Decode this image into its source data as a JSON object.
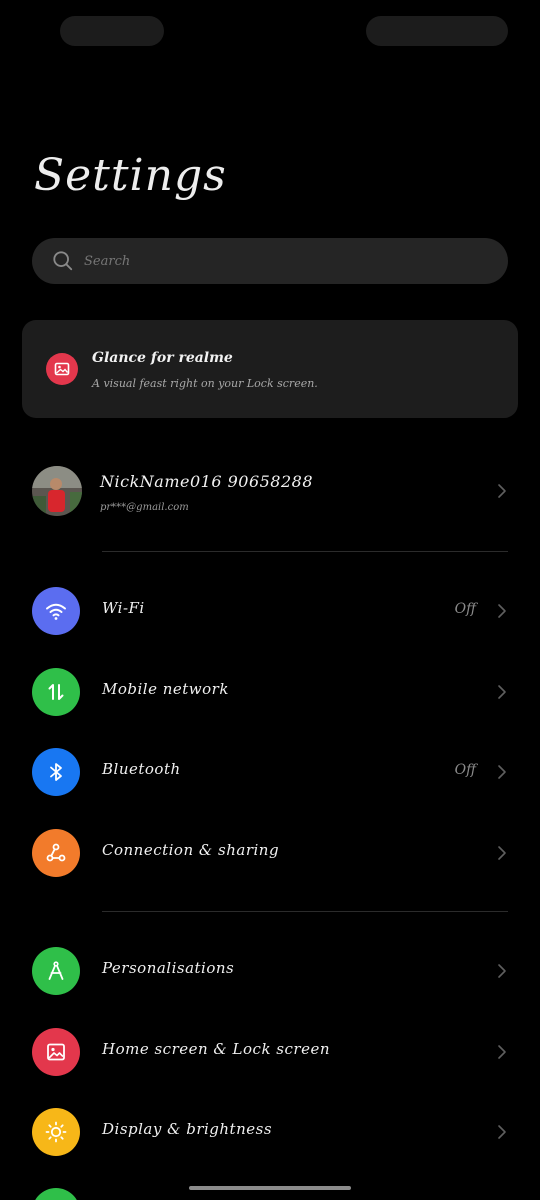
{
  "header": {
    "title": "Settings"
  },
  "search": {
    "placeholder": "Search"
  },
  "glance": {
    "title": "Glance for realme",
    "subtitle": "A visual feast right on your Lock screen.",
    "icon": "image-icon",
    "icon_color": "#e3374c"
  },
  "account": {
    "name": "NickName016 90658288",
    "email": "pr***@gmail.com"
  },
  "settings_group_1": [
    {
      "label": "Wi-Fi",
      "value": "Off",
      "icon": "wifi-icon",
      "color": "#5b6df0"
    },
    {
      "label": "Mobile network",
      "value": "",
      "icon": "mobile-data-icon",
      "color": "#2fbf49"
    },
    {
      "label": "Bluetooth",
      "value": "Off",
      "icon": "bluetooth-icon",
      "color": "#1877f2"
    },
    {
      "label": "Connection & sharing",
      "value": "",
      "icon": "share-icon",
      "color": "#f27b2b"
    }
  ],
  "settings_group_2": [
    {
      "label": "Personalisations",
      "icon": "compass-icon",
      "color": "#2fbf49"
    },
    {
      "label": "Home screen & Lock screen",
      "icon": "image-icon",
      "color": "#e3374c"
    },
    {
      "label": "Display & brightness",
      "icon": "sun-icon",
      "color": "#f7b718"
    }
  ],
  "partial_next_icon_color": "#2fbf49"
}
